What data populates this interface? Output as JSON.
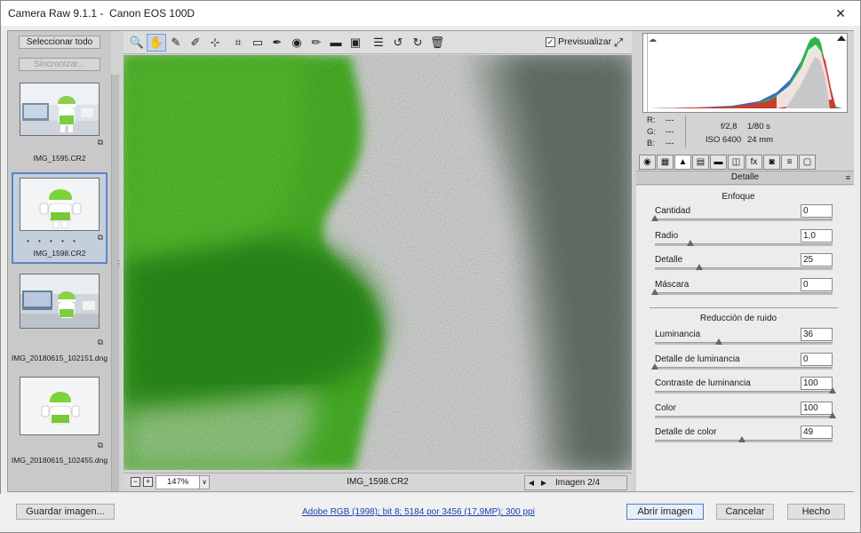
{
  "window": {
    "title": "Camera Raw 9.1.1 -  Canon EOS 100D",
    "close_glyph": "✕"
  },
  "filmstrip": {
    "select_all_label": "Seleccionar todo",
    "sync_label": "Sincronizar...",
    "items": [
      {
        "filename": "IMG_1595.CR2",
        "selected": false
      },
      {
        "filename": "IMG_1598.CR2",
        "selected": true,
        "rating_dots": "• • • • •"
      },
      {
        "filename": "IMG_20180615_102151.dng",
        "selected": false
      },
      {
        "filename": "IMG_20180615_102455.dng",
        "selected": false
      }
    ]
  },
  "toolbar": {
    "tools": [
      {
        "name": "zoom-tool",
        "glyph": "🔍",
        "active": false
      },
      {
        "name": "hand-tool",
        "glyph": "✋",
        "active": true
      },
      {
        "name": "white-balance-tool",
        "glyph": "✎",
        "active": false
      },
      {
        "name": "color-sampler-tool",
        "glyph": "✐",
        "active": false
      },
      {
        "name": "targeted-adjustment-tool",
        "glyph": "⊹",
        "active": false
      },
      {
        "name": "crop-tool",
        "glyph": "⌗",
        "active": false
      },
      {
        "name": "straighten-tool",
        "glyph": "▭",
        "active": false
      },
      {
        "name": "spot-removal-tool",
        "glyph": "✒",
        "active": false
      },
      {
        "name": "red-eye-tool",
        "glyph": "◉",
        "active": false
      },
      {
        "name": "adjustment-brush-tool",
        "glyph": "✏",
        "active": false
      },
      {
        "name": "graduated-filter-tool",
        "glyph": "▬",
        "active": false
      },
      {
        "name": "radial-filter-tool",
        "glyph": "▣",
        "active": false
      },
      {
        "name": "preferences-tool",
        "glyph": "☰",
        "active": false
      },
      {
        "name": "rotate-ccw-tool",
        "glyph": "↺",
        "active": false
      },
      {
        "name": "rotate-cw-tool",
        "glyph": "↻",
        "active": false
      },
      {
        "name": "trash-tool",
        "glyph": "🗑",
        "active": false
      }
    ],
    "preview_label": "Previsualizar",
    "preview_checked": "✓",
    "fullscreen_glyph": "⤢"
  },
  "image_bar": {
    "zoom_out_glyph": "−",
    "zoom_in_glyph": "+",
    "zoom": "147%",
    "zoom_dropdown_glyph": "∨",
    "filename": "IMG_1598.CR2",
    "prev_glyph": "◀",
    "next_glyph": "▶",
    "image_counter": "Imagen 2/4"
  },
  "metadata": {
    "r_label": "R:",
    "r_value": "---",
    "g_label": "G:",
    "g_value": "---",
    "b_label": "B:",
    "b_value": "---",
    "aperture": "f/2,8",
    "shutter": "1/80 s",
    "iso": "ISO 6400",
    "focal": "24 mm"
  },
  "panel_tabs": [
    {
      "name": "basic",
      "glyph": "◉"
    },
    {
      "name": "tone-curve",
      "glyph": "▦"
    },
    {
      "name": "detail",
      "glyph": "▲"
    },
    {
      "name": "hsl",
      "glyph": "▤"
    },
    {
      "name": "split-toning",
      "glyph": "▬"
    },
    {
      "name": "lens-corrections",
      "glyph": "◫"
    },
    {
      "name": "effects",
      "glyph": "fx"
    },
    {
      "name": "camera-calibration",
      "glyph": "◙"
    },
    {
      "name": "presets",
      "glyph": "≡"
    },
    {
      "name": "snapshots",
      "glyph": "▢"
    }
  ],
  "panel": {
    "title": "Detalle",
    "menu_glyph": "≡",
    "sharpening_title": "Enfoque",
    "sharpening": [
      {
        "label": "Cantidad",
        "value": "0",
        "pos": 0.0
      },
      {
        "label": "Radio",
        "value": "1,0",
        "pos": 0.2
      },
      {
        "label": "Detalle",
        "value": "25",
        "pos": 0.25
      },
      {
        "label": "Máscara",
        "value": "0",
        "pos": 0.0
      }
    ],
    "noise_title": "Reducción de ruido",
    "noise": [
      {
        "label": "Luminancia",
        "value": "36",
        "pos": 0.36
      },
      {
        "label": "Detalle de luminancia",
        "value": "0",
        "pos": 0.0
      },
      {
        "label": "Contraste de luminancia",
        "value": "100",
        "pos": 1.0
      },
      {
        "label": "Color",
        "value": "100",
        "pos": 1.0
      },
      {
        "label": "Detalle de color",
        "value": "49",
        "pos": 0.49
      }
    ]
  },
  "footer": {
    "save_label": "Guardar imagen...",
    "workflow_link": "Adobe RGB (1998); bit 8; 5184 por 3456 (17,9MP); 300 ppi",
    "open_label": "Abrir imagen",
    "cancel_label": "Cancelar",
    "done_label": "Hecho"
  },
  "colors": {
    "accent_selection": "#5b86c9",
    "link": "#1a3fb0",
    "image_green": "#3cb62a"
  }
}
